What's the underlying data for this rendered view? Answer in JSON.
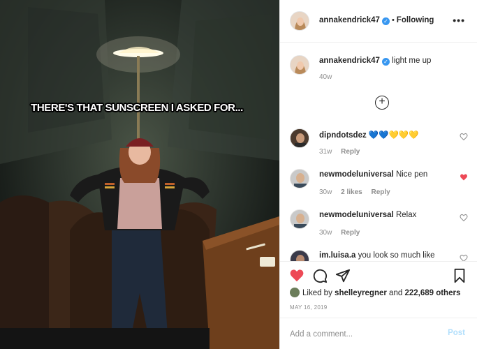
{
  "meme_text": "THERE'S THAT SUNSCREEN I ASKED FOR...",
  "header": {
    "username": "annakendrick47",
    "separator": "•",
    "follow_status": "Following",
    "more": "•••"
  },
  "caption": {
    "username": "annakendrick47",
    "text": "light me up",
    "time": "40w"
  },
  "load_more_glyph": "+",
  "comments": [
    {
      "username": "dipndotsdez",
      "text": "💙💙💛💛💛",
      "time": "31w",
      "likes": "",
      "reply": "Reply",
      "liked": false
    },
    {
      "username": "newmodeluniversal",
      "text": "Nice pen",
      "time": "30w",
      "likes": "2 likes",
      "reply": "Reply",
      "liked": true
    },
    {
      "username": "newmodeluniversal",
      "text": "Relax",
      "time": "30w",
      "likes": "",
      "reply": "Reply",
      "liked": false
    },
    {
      "username": "im.luisa.a",
      "text": "you look so much like",
      "time": "",
      "likes": "",
      "reply": "",
      "liked": false
    }
  ],
  "likes": {
    "prefix": "Liked by",
    "user": "shelleyregner",
    "joiner": "and",
    "others": "222,689 others"
  },
  "date": "MAY 16, 2019",
  "add_comment": {
    "placeholder": "Add a comment...",
    "post_label": "Post"
  },
  "colors": {
    "heart_red": "#ed4956",
    "verified_blue": "#3897f0",
    "post_disabled": "#b2dffc",
    "meta_gray": "#8e8e8e"
  },
  "icons": [
    "heart-icon",
    "comment-icon",
    "share-icon",
    "bookmark-icon",
    "verified-icon",
    "plus-circle-icon",
    "rofl-emoji-icon"
  ]
}
